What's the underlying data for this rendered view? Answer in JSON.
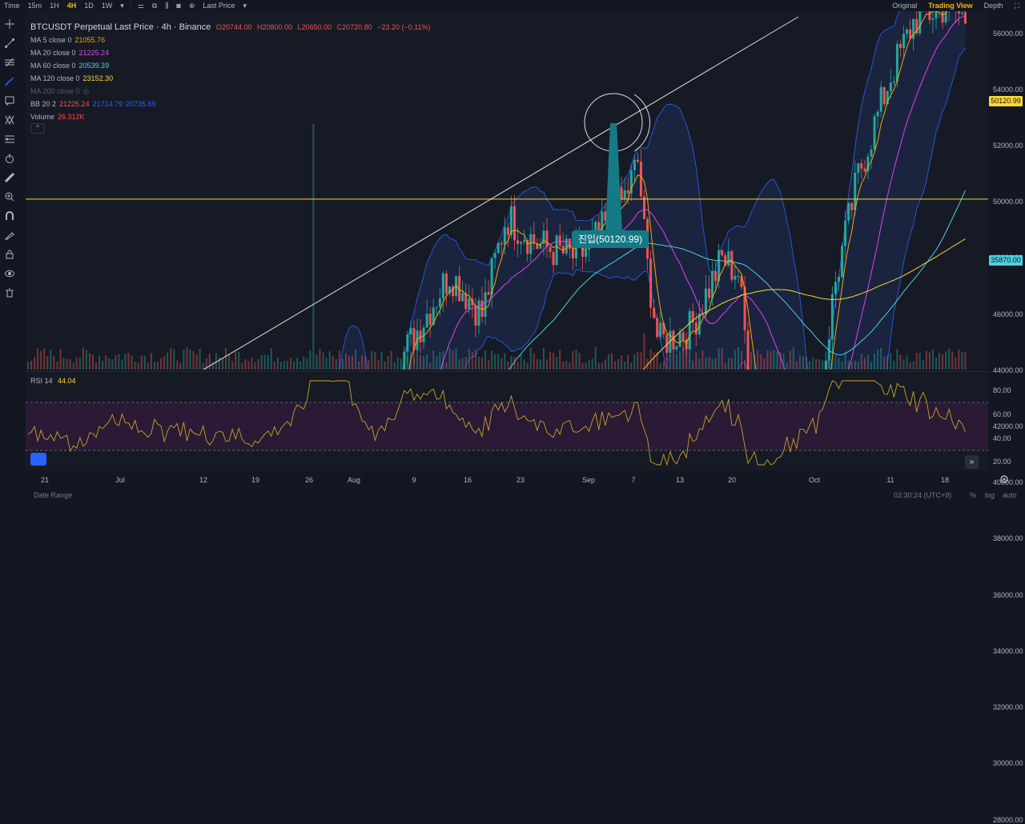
{
  "topbar": {
    "timeframes": [
      "Time",
      "15m",
      "1H",
      "4H",
      "1D",
      "1W"
    ],
    "active_timeframe": "4H",
    "price_type": "Last Price",
    "views": [
      "Original",
      "Trading View",
      "Depth"
    ],
    "active_view": "Trading View"
  },
  "legend": {
    "title": "BTCUSDT Perpetual Last Price · 4h · Binance",
    "ohlc": {
      "o": "O20744.00",
      "h": "H20800.00",
      "l": "L20650.00",
      "c": "C20720.80",
      "chg": "−23.20 (−0.11%)"
    },
    "indicators": [
      {
        "label": "MA 5 close 0",
        "value": "21055.76",
        "color": "#f7a600"
      },
      {
        "label": "MA 20 close 0",
        "value": "21225.24",
        "color": "#e040fb"
      },
      {
        "label": "MA 60 close 0",
        "value": "20539.39",
        "color": "#4dd0e1"
      },
      {
        "label": "MA 120 close 0",
        "value": "23152.30",
        "color": "#fdd835"
      },
      {
        "label": "MA 200 close 0",
        "value": "",
        "color": "#555a66"
      }
    ],
    "bb": {
      "label": "BB 20 2",
      "v1": "21225.24",
      "v2": "21714.79",
      "v3": "20735.69"
    },
    "volume": {
      "label": "Volume",
      "value": "26.312K"
    },
    "collapse": "^"
  },
  "price_axis": {
    "ticks": [
      "56000.00",
      "54000.00",
      "52000.00",
      "50000.00",
      "48000.00",
      "46000.00",
      "44000.00",
      "42000.00",
      "40000.00",
      "38000.00",
      "36000.00",
      "34000.00",
      "32000.00",
      "30000.00",
      "28000.00"
    ],
    "marker_yellow": "50120.99",
    "marker_cyan": "35870.00"
  },
  "rsi": {
    "label": "RSI 14",
    "value": "44.04",
    "ticks": [
      "80.00",
      "60.00",
      "40.00",
      "20.00"
    ]
  },
  "date_axis": {
    "ticks": [
      "21",
      "Jul",
      "12",
      "19",
      "26",
      "Aug",
      "9",
      "16",
      "23",
      "Sep",
      "7",
      "13",
      "20",
      "Oct",
      "11",
      "18"
    ]
  },
  "callout": {
    "text": "진입(50120.99)"
  },
  "bottombar": {
    "left": "Date Range",
    "time": "02:30:24 (UTC+9)",
    "percent": "%",
    "log": "log",
    "auto": "auto"
  },
  "colors": {
    "up": "#26a69a",
    "down": "#ef5350",
    "ma5": "#f7a600",
    "ma20": "#e040fb",
    "ma60": "#4dd0e1",
    "ma120": "#fdd835",
    "bb": "#2962ff",
    "level_yellow": "#fdd835",
    "level_cyan": "#4dd0e1",
    "rsi_line": "#c9a227",
    "rsi_band": "#2a1a35"
  },
  "icons": [
    "crosshair-icon",
    "trendline-icon",
    "fib-icon",
    "brush-icon",
    "text-icon",
    "pattern-icon",
    "prediction-icon",
    "power-icon",
    "ruler-icon",
    "zoom-icon",
    "magnet-icon",
    "lock-drawing-icon",
    "lock-icon",
    "eye-icon",
    "trash-icon"
  ]
}
